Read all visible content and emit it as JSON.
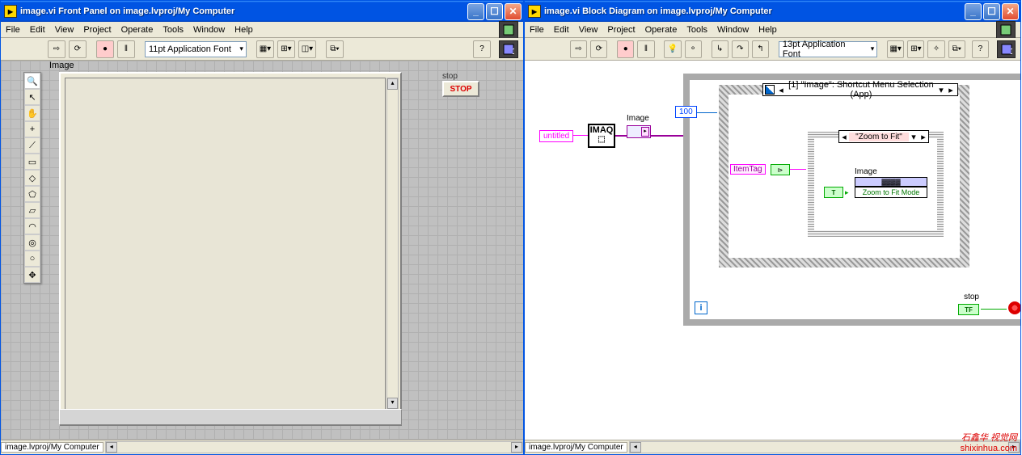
{
  "left_window": {
    "title": "image.vi Front Panel on image.lvproj/My Computer",
    "menus": [
      "File",
      "Edit",
      "View",
      "Project",
      "Operate",
      "Tools",
      "Window",
      "Help"
    ],
    "font": "11pt Application Font",
    "image_label": "Image",
    "stop_label": "stop",
    "stop_btn": "STOP",
    "status": "image.lvproj/My Computer"
  },
  "right_window": {
    "title": "image.vi Block Diagram on image.lvproj/My Computer",
    "menus": [
      "File",
      "Edit",
      "View",
      "Project",
      "Operate",
      "Tools",
      "Window",
      "Help"
    ],
    "font": "13pt Application Font",
    "status": "image.lvproj/My Computer",
    "diagram": {
      "wait_const": "100",
      "imaq_const": "untitled",
      "imaq_label": "IMAQ",
      "img_term_label": "Image",
      "event_title": "[1] \"Image\": Shortcut Menu Selection (App)",
      "item_tag": "ItemTag",
      "case_title": "\"Zoom to Fit\"",
      "prop_node_header": "Image",
      "prop_node_item": "Zoom to Fit Mode",
      "stop_term_label": "stop",
      "stop_term": "TF",
      "loop_i": "i",
      "true_const": "T"
    }
  },
  "watermark": {
    "cn": "石鑫华 视觉网",
    "url": "shixinhua.com"
  }
}
